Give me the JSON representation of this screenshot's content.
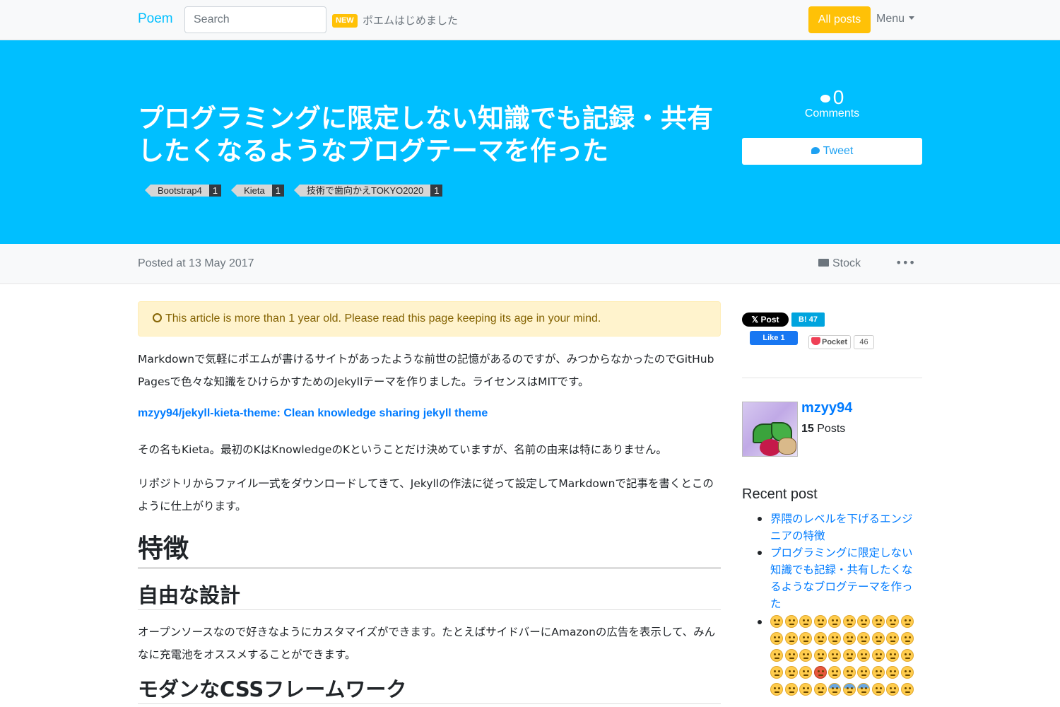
{
  "navbar": {
    "brand": "Poem",
    "search_placeholder": "Search",
    "badge": "NEW",
    "note": "ポエムはじめました",
    "all_posts": "All posts",
    "menu": "Menu"
  },
  "hero": {
    "title": "プログラミングに限定しない知識でも記録・共有したくなるようなブログテーマを作った",
    "tags": [
      {
        "name": "Bootstrap4",
        "count": "1"
      },
      {
        "name": "Kieta",
        "count": "1"
      },
      {
        "name": "技術で歯向かえTOKYO2020",
        "count": "1"
      }
    ],
    "comments_count": "0",
    "comments_label": "Comments",
    "tweet": "Tweet"
  },
  "meta": {
    "posted": "Posted at 13 May 2017",
    "stock": "Stock",
    "more": "•••"
  },
  "article": {
    "alert": "This article is more than 1 year old. Please read this page keeping its age in your mind.",
    "p1": "Markdownで気軽にポエムが書けるサイトがあったような前世の記憶があるのですが、みつからなかったのでGitHub Pagesで色々な知識をひけらかすためのJekyllテーマを作りました。ライセンスはMITです。",
    "link": "mzyy94/jekyll-kieta-theme: Clean knowledge sharing jekyll theme",
    "p2": "その名もKieta。最初のKはKnowledgeのKということだけ決めていますが、名前の由来は特にありません。",
    "p3": "リポジトリからファイル一式をダウンロードしてきて、Jekyllの作法に従って設定してMarkdownで記事を書くとこのように仕上がります。",
    "h1": "特徴",
    "h2a": "自由な設計",
    "p4": "オープンソースなので好きなようにカスタマイズができます。たとえばサイドバーにAmazonの広告を表示して、みんなに充電池をオススメすることができます。",
    "h2b": "モダンなCSSフレームワーク"
  },
  "sidebar": {
    "x_post": "Post",
    "hatena": "B! 47",
    "like": "Like 1",
    "pocket": "Pocket",
    "pocket_count": "46",
    "author_name": "mzyy94",
    "author_posts_num": "15",
    "author_posts_label": " Posts",
    "recent_title": "Recent post",
    "recent": [
      "界隈のレベルを下げるエンジニアの特徴",
      "プログラミングに限定しない知識でも記録・共有したくなるようなブログテーマを作った"
    ]
  }
}
